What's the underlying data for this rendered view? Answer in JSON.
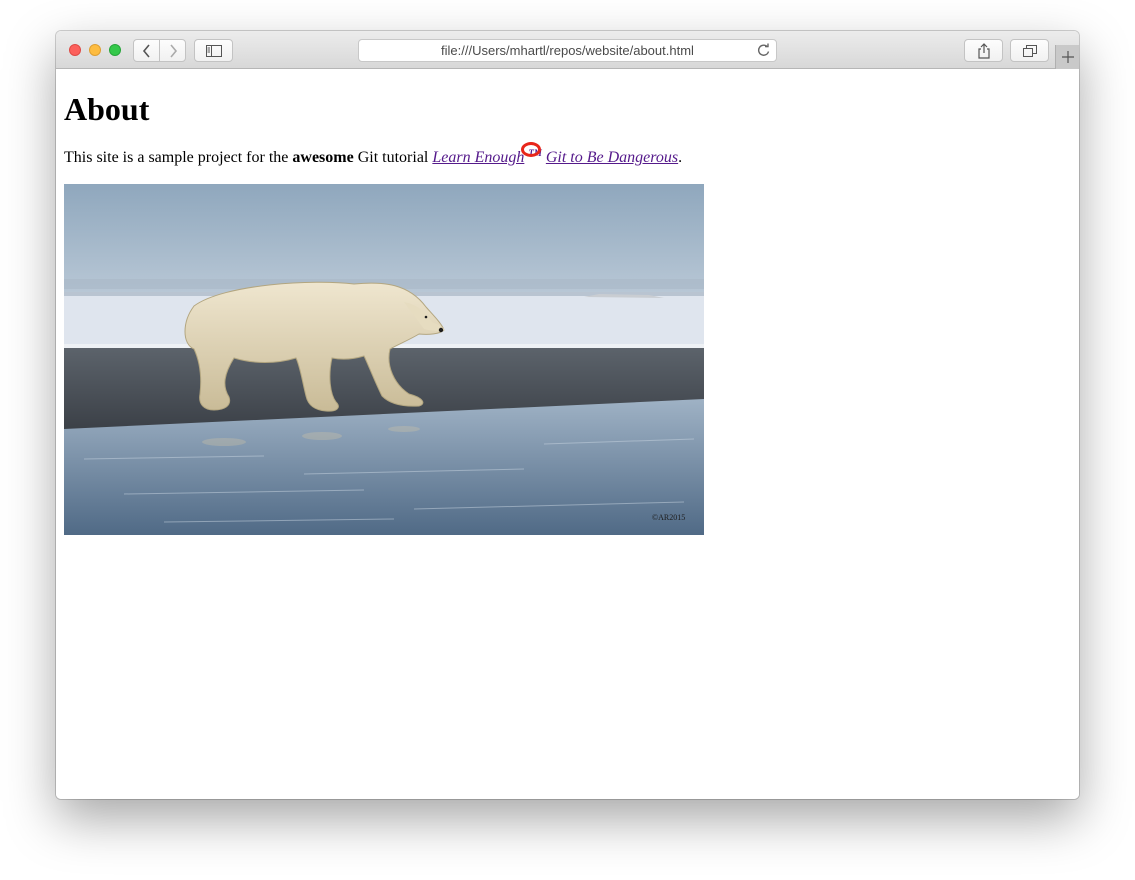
{
  "browser": {
    "url": "file:///Users/mhartl/repos/website/about.html",
    "icons": {
      "back": "chevron-left-icon",
      "forward": "chevron-right-icon",
      "sidebar": "sidebar-icon",
      "reload": "reload-icon",
      "share": "share-icon",
      "tabs": "tabs-overview-icon",
      "new_tab": "plus-icon"
    },
    "colors": {
      "close": "#fc605c",
      "minimize": "#fdbc40",
      "zoom": "#34c84a"
    }
  },
  "page": {
    "heading": "About",
    "intro_prefix": "This site is a sample project for the",
    "intro_bold": "awesome",
    "intro_middle": "Git tutorial",
    "link_part1": "Learn Enough",
    "trademark": "TM",
    "link_part2": "Git to Be Dangerous",
    "intro_suffix": ".",
    "link_color": "#551a8b",
    "highlight_color": "#e8261b",
    "image_alt": "polar bear walking on a beach",
    "image_watermark": "©AR2015"
  }
}
